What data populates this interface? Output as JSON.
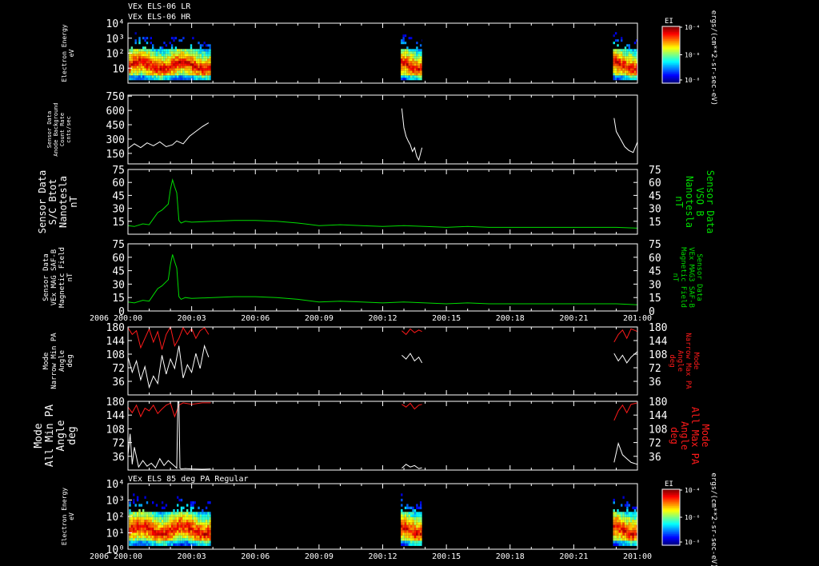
{
  "header": {
    "line1": "VEx ELS-06 LR",
    "line2": "VEx ELS-06 HR",
    "bottom_panel_title": "VEx ELS 85 deg PA Regular"
  },
  "colorbar": {
    "label": "EI",
    "units": "ergs/(cm**2-sr-sec-eV)",
    "ticks": [
      "10⁻⁴",
      "10⁻⁶",
      "10⁻⁸"
    ]
  },
  "colors": {
    "white": "#ffffff",
    "green": "#00dd00",
    "red": "#ff1a1a",
    "background": "#000000"
  },
  "x_axis": {
    "year_label": "2006",
    "ticks": [
      "200:00",
      "200:03",
      "200:06",
      "200:09",
      "200:12",
      "200:15",
      "200:18",
      "200:21",
      "201:00"
    ],
    "range_hours": [
      0,
      24
    ]
  },
  "chart_data": [
    {
      "type": "heatmap",
      "panel": "p1",
      "ylabel": [
        "Electron Energy",
        "eV"
      ],
      "y_scale": "log",
      "ylim": [
        1,
        10000
      ],
      "y_ticks": [
        {
          "v": 10,
          "t": "10"
        },
        {
          "v": 100,
          "t": "10²"
        },
        {
          "v": 1000,
          "t": "10³"
        },
        {
          "v": 10000,
          "t": "10⁴"
        }
      ],
      "data_intervals_hours": [
        [
          0.05,
          3.9
        ],
        [
          12.85,
          13.85
        ],
        [
          22.85,
          24
        ]
      ]
    },
    {
      "type": "line",
      "panel": "p2",
      "ylabel": [
        "Sensor Data",
        "Anode Background",
        "Count Rate",
        "cnts/sec"
      ],
      "ylim": [
        40,
        760
      ],
      "y_ticks": [
        150,
        300,
        450,
        600,
        750
      ],
      "series": [
        {
          "color": "#ffffff",
          "segments": [
            {
              "x": [
                0.0,
                0.3,
                0.6,
                0.9,
                1.2,
                1.5,
                1.8,
                2.1,
                2.3,
                2.6,
                2.9,
                3.2,
                3.5,
                3.8
              ],
              "y": [
                200,
                250,
                210,
                260,
                230,
                270,
                220,
                240,
                280,
                250,
                330,
                380,
                430,
                470
              ]
            },
            {
              "x": [
                12.9,
                13.0,
                13.1,
                13.2,
                13.3,
                13.4,
                13.5,
                13.6,
                13.7,
                13.85
              ],
              "y": [
                620,
                420,
                330,
                280,
                240,
                170,
                210,
                120,
                80,
                210
              ]
            },
            {
              "x": [
                22.9,
                23.0,
                23.2,
                23.4,
                23.6,
                23.8,
                24.0
              ],
              "y": [
                520,
                380,
                300,
                220,
                180,
                160,
                270
              ]
            }
          ]
        }
      ]
    },
    {
      "type": "line",
      "panel": "p3",
      "ylabel": [
        "Sensor Data",
        "S/C Btot",
        "Nanotesla",
        "nT"
      ],
      "ylabel_right": [
        "Sensor Data",
        "VSO B",
        "Nanotesla",
        "nT"
      ],
      "ylim": [
        0,
        75
      ],
      "y_ticks": [
        15,
        30,
        45,
        60,
        75
      ],
      "series": [
        {
          "color": "#00dd00",
          "segments": [
            {
              "x": [
                0.0,
                0.3,
                0.7,
                1.0,
                1.2,
                1.4,
                1.6,
                1.9,
                2.0,
                2.1,
                2.2,
                2.3,
                2.4,
                2.5,
                2.7,
                3.0,
                4.0,
                5.0,
                6.0,
                7.0,
                8.0,
                9.0,
                10.0,
                11.0,
                12.0,
                13.0,
                14.0,
                15.0,
                16.0,
                17.0,
                18.0,
                19.0,
                20.0,
                21.0,
                22.0,
                23.0,
                24.0
              ],
              "y": [
                10,
                9,
                12,
                11,
                18,
                25,
                28,
                35,
                52,
                63,
                55,
                48,
                16,
                13,
                15,
                14,
                15,
                16,
                16,
                15,
                13,
                10,
                11,
                10,
                9,
                10,
                9,
                8,
                9,
                8,
                8,
                8,
                8,
                8,
                8,
                8,
                7
              ]
            }
          ]
        }
      ]
    },
    {
      "type": "line",
      "panel": "p4",
      "ylabel": [
        "Sensor Data",
        "VEx MAG SAF-B",
        "Magnetic Field",
        "nT"
      ],
      "ylabel_right": [
        "Sensor Data",
        "VEx MAG3 SAF-B",
        "Magnetic Field",
        "nT"
      ],
      "ylim": [
        0,
        75
      ],
      "y_ticks": [
        0,
        15,
        30,
        45,
        60,
        75
      ],
      "series": [
        {
          "color": "#00dd00",
          "segments": [
            {
              "x": [
                0.0,
                0.3,
                0.7,
                1.0,
                1.2,
                1.4,
                1.6,
                1.9,
                2.0,
                2.1,
                2.2,
                2.3,
                2.4,
                2.5,
                2.7,
                3.0,
                4.0,
                5.0,
                6.0,
                7.0,
                8.0,
                9.0,
                10.0,
                11.0,
                12.0,
                13.0,
                14.0,
                15.0,
                16.0,
                17.0,
                18.0,
                19.0,
                20.0,
                21.0,
                22.0,
                23.0,
                24.0
              ],
              "y": [
                10,
                9,
                12,
                11,
                18,
                25,
                28,
                35,
                52,
                63,
                55,
                48,
                16,
                13,
                15,
                14,
                15,
                16,
                16,
                15,
                13,
                10,
                11,
                10,
                9,
                10,
                9,
                8,
                9,
                8,
                8,
                8,
                8,
                8,
                8,
                8,
                7
              ]
            }
          ]
        }
      ]
    },
    {
      "type": "line",
      "panel": "p5",
      "ylabel": [
        "Mode",
        "Narrow Min PA",
        "Angle",
        "deg"
      ],
      "ylabel_right": [
        "Mode",
        "Narrow Max PA",
        "Angle",
        "deg"
      ],
      "ylim": [
        0,
        180
      ],
      "y_ticks": [
        36,
        72,
        108,
        144,
        180
      ],
      "series": [
        {
          "color": "#ff1a1a",
          "segments": [
            {
              "x": [
                0.0,
                0.2,
                0.4,
                0.6,
                0.8,
                1.0,
                1.2,
                1.4,
                1.6,
                1.8,
                2.0,
                2.2,
                2.4,
                2.6,
                2.8,
                3.0,
                3.2,
                3.4,
                3.6,
                3.8
              ],
              "y": [
                178,
                160,
                170,
                125,
                150,
                175,
                140,
                168,
                120,
                160,
                180,
                130,
                150,
                178,
                160,
                176,
                150,
                170,
                178,
                160
              ]
            },
            {
              "x": [
                12.9,
                13.1,
                13.3,
                13.5,
                13.7,
                13.85
              ],
              "y": [
                170,
                160,
                175,
                165,
                172,
                168
              ]
            },
            {
              "x": [
                22.9,
                23.1,
                23.3,
                23.5,
                23.7,
                24.0
              ],
              "y": [
                140,
                160,
                172,
                150,
                175,
                168
              ]
            }
          ]
        },
        {
          "color": "#ffffff",
          "segments": [
            {
              "x": [
                0.0,
                0.2,
                0.4,
                0.6,
                0.8,
                1.0,
                1.2,
                1.4,
                1.6,
                1.8,
                2.0,
                2.2,
                2.4,
                2.6,
                2.8,
                3.0,
                3.2,
                3.4,
                3.6,
                3.8
              ],
              "y": [
                100,
                60,
                90,
                40,
                75,
                20,
                50,
                30,
                105,
                55,
                95,
                70,
                130,
                45,
                80,
                60,
                110,
                70,
                130,
                100
              ]
            },
            {
              "x": [
                12.9,
                13.1,
                13.3,
                13.5,
                13.7,
                13.85
              ],
              "y": [
                105,
                95,
                110,
                90,
                100,
                85
              ]
            },
            {
              "x": [
                22.9,
                23.1,
                23.3,
                23.5,
                23.7,
                24.0
              ],
              "y": [
                110,
                90,
                105,
                85,
                100,
                115
              ]
            }
          ]
        }
      ]
    },
    {
      "type": "line",
      "panel": "p6",
      "ylabel": [
        "Mode",
        "All Min PA",
        "Angle",
        "deg"
      ],
      "ylabel_right": [
        "Mode",
        "All Max PA",
        "Angle",
        "deg"
      ],
      "ylim": [
        0,
        180
      ],
      "y_ticks": [
        36,
        72,
        108,
        144,
        180
      ],
      "series": [
        {
          "color": "#ff1a1a",
          "segments": [
            {
              "x": [
                0.0,
                0.2,
                0.4,
                0.6,
                0.8,
                1.0,
                1.2,
                1.4,
                1.6,
                1.8,
                2.0,
                2.2,
                2.4,
                2.6,
                3.0,
                3.5,
                3.9
              ],
              "y": [
                165,
                150,
                170,
                140,
                162,
                155,
                170,
                148,
                160,
                170,
                175,
                140,
                170,
                176,
                172,
                176,
                176
              ]
            },
            {
              "x": [
                12.9,
                13.1,
                13.3,
                13.5,
                13.7,
                13.85
              ],
              "y": [
                172,
                165,
                175,
                160,
                170,
                172
              ]
            },
            {
              "x": [
                22.9,
                23.1,
                23.3,
                23.5,
                23.7,
                24.0
              ],
              "y": [
                130,
                155,
                170,
                150,
                172,
                176
              ]
            }
          ]
        },
        {
          "color": "#ffffff",
          "segments": [
            {
              "x": [
                0.0,
                0.1,
                0.2,
                0.3,
                0.5,
                0.7,
                0.9,
                1.1,
                1.3,
                1.5,
                1.7,
                1.9,
                2.1,
                2.3,
                2.35,
                2.4,
                2.45,
                2.5,
                2.7,
                3.0,
                3.5,
                3.9
              ],
              "y": [
                40,
                95,
                15,
                60,
                8,
                25,
                10,
                18,
                6,
                30,
                12,
                25,
                15,
                5,
                178,
                178,
                5,
                3,
                4,
                3,
                2,
                3
              ]
            },
            {
              "x": [
                12.9,
                13.1,
                13.3,
                13.5,
                13.7,
                13.85
              ],
              "y": [
                5,
                15,
                8,
                12,
                4,
                6
              ]
            },
            {
              "x": [
                22.9,
                23.1,
                23.3,
                23.5,
                23.7,
                24.0
              ],
              "y": [
                20,
                70,
                40,
                30,
                20,
                15
              ]
            }
          ]
        }
      ]
    },
    {
      "type": "heatmap",
      "panel": "p7",
      "ylabel": [
        "Electron Energy",
        "eV"
      ],
      "y_scale": "log",
      "ylim": [
        1,
        10000
      ],
      "y_ticks": [
        {
          "v": 1,
          "t": "10⁰"
        },
        {
          "v": 10,
          "t": "10¹"
        },
        {
          "v": 100,
          "t": "10²"
        },
        {
          "v": 1000,
          "t": "10³"
        },
        {
          "v": 10000,
          "t": "10⁴"
        }
      ],
      "data_intervals_hours": [
        [
          0.05,
          3.9
        ],
        [
          12.85,
          13.85
        ],
        [
          22.85,
          24
        ]
      ]
    }
  ]
}
